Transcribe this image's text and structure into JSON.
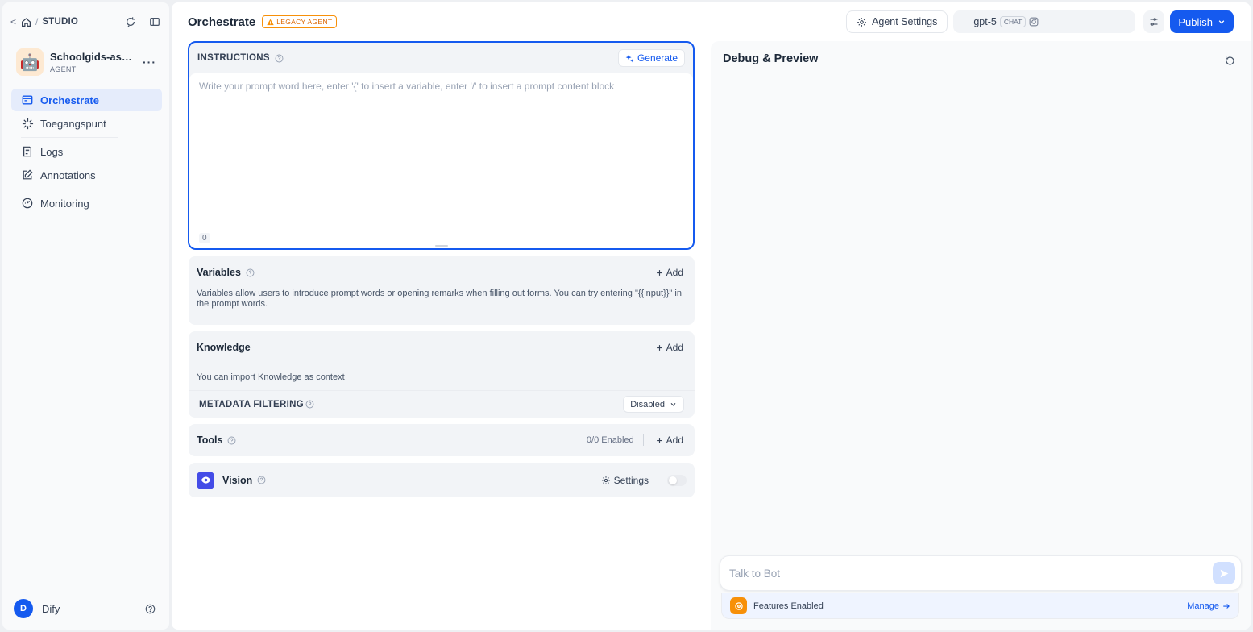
{
  "sidebar": {
    "breadcrumb": {
      "back": "<",
      "separator": "/",
      "section": "STUDIO"
    },
    "app": {
      "name": "Schoolgids-assi...",
      "type": "AGENT",
      "emoji": "🤖",
      "more": "···"
    },
    "nav": [
      {
        "label": "Orchestrate",
        "icon": "window-icon",
        "active": true
      },
      {
        "label": "Toegangspunt",
        "icon": "sparkle-burst-icon"
      },
      {
        "label": "Logs",
        "icon": "file-list-icon"
      },
      {
        "label": "Annotations",
        "icon": "edit-note-icon"
      },
      {
        "label": "Monitoring",
        "icon": "dashboard-gauge-icon"
      }
    ],
    "user": {
      "initial": "D",
      "name": "Dify"
    }
  },
  "header": {
    "title": "Orchestrate",
    "badge": "LEGACY AGENT",
    "agent_settings": "Agent Settings",
    "model": {
      "name": "gpt-5",
      "tag": "CHAT"
    },
    "publish": "Publish"
  },
  "instructions": {
    "label": "INSTRUCTIONS",
    "generate": "Generate",
    "placeholder": "Write your prompt word here, enter '{' to insert a variable, enter '/' to insert a prompt content block",
    "count": "0"
  },
  "variables": {
    "title": "Variables",
    "add": "Add",
    "description": "Variables allow users to introduce prompt words or opening remarks when filling out forms. You can try entering \"{{input}}\" in the prompt words."
  },
  "knowledge": {
    "title": "Knowledge",
    "add": "Add",
    "description": "You can import Knowledge as context",
    "metadata_label": "METADATA FILTERING",
    "metadata_value": "Disabled"
  },
  "tools": {
    "title": "Tools",
    "status": "0/0 Enabled",
    "add": "Add"
  },
  "vision": {
    "title": "Vision",
    "settings": "Settings",
    "enabled": false
  },
  "debug": {
    "title": "Debug & Preview",
    "input_placeholder": "Talk to Bot",
    "features_label": "Features Enabled",
    "manage": "Manage"
  },
  "colors": {
    "accent": "#155aef",
    "warning": "#f79009",
    "vision": "#444ce7"
  }
}
